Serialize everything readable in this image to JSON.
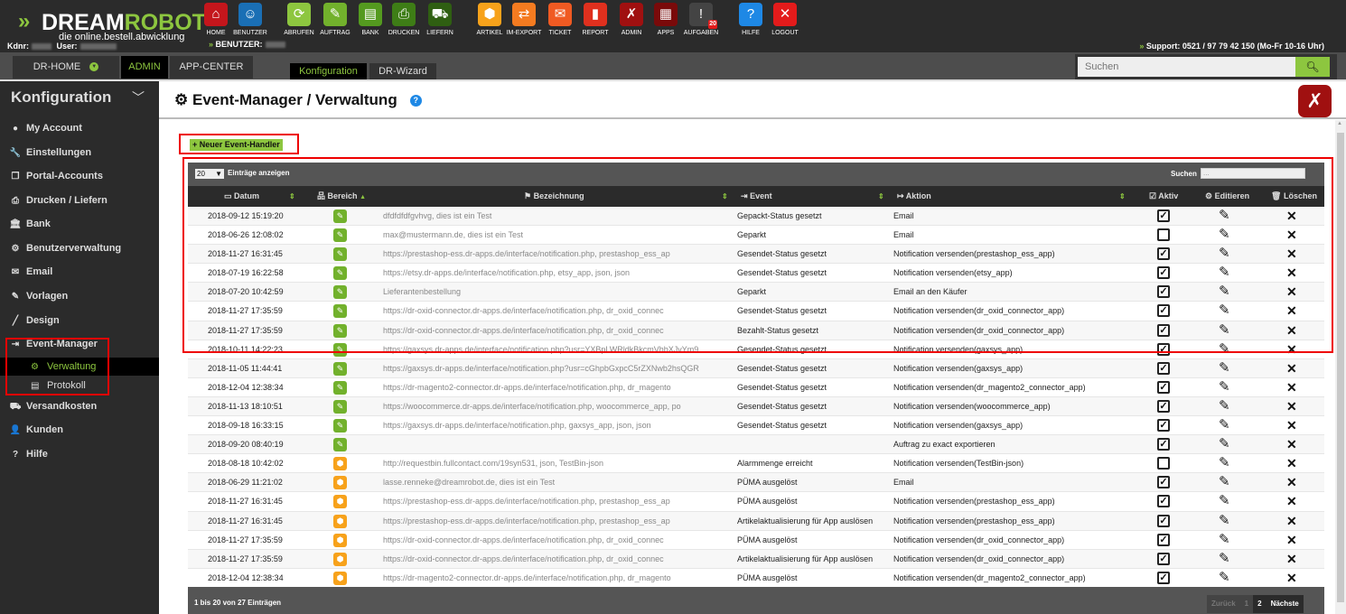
{
  "logo": {
    "brand_a": "DREAM",
    "brand_b": "ROBOT",
    "tagline": "die online.bestell.abwicklung"
  },
  "account": {
    "kdnr_label": "Kdnr:",
    "user_label": "User:",
    "benutzer_label": "BENUTZER:"
  },
  "support": "Support: 0521 / 97 79 42 150 (Mo-Fr 10-16 Uhr)",
  "toolbar": [
    {
      "label": "HOME",
      "icon": "home-icon",
      "glyph": "⌂",
      "color": "#c4161c"
    },
    {
      "label": "BENUTZER",
      "icon": "user-icon",
      "glyph": "☺",
      "color": "#1a6fb5"
    },
    {
      "label": "ABRUFEN",
      "icon": "download-icon",
      "glyph": "⟳",
      "color": "#8dc63f"
    },
    {
      "label": "AUFTRAG",
      "icon": "order-icon",
      "glyph": "✎",
      "color": "#72b12c"
    },
    {
      "label": "BANK",
      "icon": "bank-icon",
      "glyph": "▤",
      "color": "#549a1f"
    },
    {
      "label": "DRUCKEN",
      "icon": "printer-icon",
      "glyph": "⎙",
      "color": "#3e7d16"
    },
    {
      "label": "LIEFERN",
      "icon": "delivery-icon",
      "glyph": "⛟",
      "color": "#2f5f12"
    },
    {
      "label": "ARTIKEL",
      "icon": "article-icon",
      "glyph": "⬢",
      "color": "#f7a21b"
    },
    {
      "label": "IM-EXPORT",
      "icon": "import-export-icon",
      "glyph": "⇄",
      "color": "#f47b20"
    },
    {
      "label": "TICKET",
      "icon": "ticket-icon",
      "glyph": "✉",
      "color": "#f05a22"
    },
    {
      "label": "REPORT",
      "icon": "report-icon",
      "glyph": "▮",
      "color": "#e0301e"
    },
    {
      "label": "ADMIN",
      "icon": "admin-tools-icon",
      "glyph": "✗",
      "color": "#a01010"
    },
    {
      "label": "APPS",
      "icon": "apps-icon",
      "glyph": "▦",
      "color": "#7a0a0a"
    },
    {
      "label": "AUFGABEN",
      "icon": "tasks-icon",
      "glyph": "!",
      "color": "#444444",
      "badge": "20"
    },
    {
      "label": "HILFE",
      "icon": "help-icon",
      "glyph": "?",
      "color": "#1e88e5"
    },
    {
      "label": "LOGOUT",
      "icon": "logout-icon",
      "glyph": "✕",
      "color": "#e31b1b"
    }
  ],
  "nav": {
    "tabs": [
      "DR-HOME",
      "ADMIN",
      "APP-CENTER"
    ],
    "active_tab": "ADMIN",
    "subtabs": [
      "Konfiguration",
      "DR-Wizard"
    ],
    "active_subtab": "Konfiguration",
    "search_placeholder": "Suchen"
  },
  "sidebar": {
    "title": "Konfiguration",
    "items": [
      {
        "label": "My Account",
        "icon": "user-circle-icon",
        "glyph": "●"
      },
      {
        "label": "Einstellungen",
        "icon": "wrench-icon",
        "glyph": "🔧"
      },
      {
        "label": "Portal-Accounts",
        "icon": "copy-icon",
        "glyph": "❐"
      },
      {
        "label": "Drucken / Liefern",
        "icon": "printer-icon",
        "glyph": "⎙"
      },
      {
        "label": "Bank",
        "icon": "bank-icon",
        "glyph": "🏛"
      },
      {
        "label": "Benutzerverwaltung",
        "icon": "users-cog-icon",
        "glyph": "⚙"
      },
      {
        "label": "Email",
        "icon": "envelope-icon",
        "glyph": "✉"
      },
      {
        "label": "Vorlagen",
        "icon": "edit-icon",
        "glyph": "✎"
      },
      {
        "label": "Design",
        "icon": "brush-icon",
        "glyph": "╱"
      },
      {
        "label": "Event-Manager",
        "icon": "sign-in-icon",
        "glyph": "⇥"
      },
      {
        "label": "Versandkosten",
        "icon": "truck-icon",
        "glyph": "⛟"
      },
      {
        "label": "Kunden",
        "icon": "person-icon",
        "glyph": "👤"
      },
      {
        "label": "Hilfe",
        "icon": "question-circle-icon",
        "glyph": "?"
      }
    ],
    "subitems": [
      {
        "label": "Verwaltung",
        "icon": "cog-icon",
        "glyph": "⚙",
        "active": true
      },
      {
        "label": "Protokoll",
        "icon": "log-icon",
        "glyph": "▤",
        "active": false
      }
    ]
  },
  "page": {
    "title": "Event-Manager / Verwaltung",
    "new_button": "+ Neuer Event-Handler"
  },
  "table": {
    "length_value": "20",
    "length_label": "Einträge anzeigen",
    "search_label": "Suchen",
    "search_placeholder": "...",
    "columns": {
      "datum": "Datum",
      "bereich": "Bereich",
      "bezeichnung": "Bezeichnung",
      "event": "Event",
      "aktion": "Aktion",
      "aktiv": "Aktiv",
      "editieren": "Editieren",
      "loeschen": "Löschen"
    },
    "rows": [
      {
        "date": "2018-09-12 15:19:20",
        "area": "order",
        "bez": "dfdfdfdfgvhvg, dies ist ein Test",
        "event": "Gepackt-Status gesetzt",
        "action": "Email",
        "active": true
      },
      {
        "date": "2018-06-26 12:08:02",
        "area": "order",
        "bez": "max@mustermann.de, dies ist ein Test",
        "event": "Geparkt",
        "action": "Email",
        "active": false
      },
      {
        "date": "2018-11-27 16:31:45",
        "area": "order",
        "bez": "https://prestashop-ess.dr-apps.de/interface/notification.php, prestashop_ess_ap",
        "event": "Gesendet-Status gesetzt",
        "action": "Notification versenden(prestashop_ess_app)",
        "active": true
      },
      {
        "date": "2018-07-19 16:22:58",
        "area": "order",
        "bez": "https://etsy.dr-apps.de/interface/notification.php, etsy_app, json, json",
        "event": "Gesendet-Status gesetzt",
        "action": "Notification versenden(etsy_app)",
        "active": true
      },
      {
        "date": "2018-07-20 10:42:59",
        "area": "order",
        "bez": "Lieferantenbestellung",
        "event": "Geparkt",
        "action": "Email an den Käufer",
        "active": true
      },
      {
        "date": "2018-11-27 17:35:59",
        "area": "order",
        "bez": "https://dr-oxid-connector.dr-apps.de/interface/notification.php, dr_oxid_connec",
        "event": "Gesendet-Status gesetzt",
        "action": "Notification versenden(dr_oxid_connector_app)",
        "active": true
      },
      {
        "date": "2018-11-27 17:35:59",
        "area": "order",
        "bez": "https://dr-oxid-connector.dr-apps.de/interface/notification.php, dr_oxid_connec",
        "event": "Bezahlt-Status gesetzt",
        "action": "Notification versenden(dr_oxid_connector_app)",
        "active": true
      },
      {
        "date": "2018-10-11 14:22:23",
        "area": "order",
        "bez": "https://gaxsys.dr-apps.de/interface/notification.php?usr=YXBpLWRldkBkcmVhbXJvYm9",
        "event": "Gesendet-Status gesetzt",
        "action": "Notification versenden(gaxsys_app)",
        "active": true
      },
      {
        "date": "2018-11-05 11:44:41",
        "area": "order",
        "bez": "https://gaxsys.dr-apps.de/interface/notification.php?usr=cGhpbGxpcC5rZXNwb2hsQGR",
        "event": "Gesendet-Status gesetzt",
        "action": "Notification versenden(gaxsys_app)",
        "active": true
      },
      {
        "date": "2018-12-04 12:38:34",
        "area": "order",
        "bez": "https://dr-magento2-connector.dr-apps.de/interface/notification.php, dr_magento",
        "event": "Gesendet-Status gesetzt",
        "action": "Notification versenden(dr_magento2_connector_app)",
        "active": true
      },
      {
        "date": "2018-11-13 18:10:51",
        "area": "order",
        "bez": "https://woocommerce.dr-apps.de/interface/notification.php, woocommerce_app, po",
        "event": "Gesendet-Status gesetzt",
        "action": "Notification versenden(woocommerce_app)",
        "active": true
      },
      {
        "date": "2018-09-18 16:33:15",
        "area": "order",
        "bez": "https://gaxsys.dr-apps.de/interface/notification.php, gaxsys_app, json, json",
        "event": "Gesendet-Status gesetzt",
        "action": "Notification versenden(gaxsys_app)",
        "active": true
      },
      {
        "date": "2018-09-20 08:40:19",
        "area": "order",
        "bez": "",
        "event": "",
        "action": "Auftrag zu exact exportieren",
        "active": true
      },
      {
        "date": "2018-08-18 10:42:02",
        "area": "article",
        "bez": "http://requestbin.fullcontact.com/19syn531, json, TestBin-json",
        "event": "Alarmmenge erreicht",
        "action": "Notification versenden(TestBin-json)",
        "active": false
      },
      {
        "date": "2018-06-29 11:21:02",
        "area": "article",
        "bez": "lasse.renneke@dreamrobot.de, dies ist ein Test",
        "event": "PÜMA ausgelöst",
        "action": "Email",
        "active": true
      },
      {
        "date": "2018-11-27 16:31:45",
        "area": "article",
        "bez": "https://prestashop-ess.dr-apps.de/interface/notification.php, prestashop_ess_ap",
        "event": "PÜMA ausgelöst",
        "action": "Notification versenden(prestashop_ess_app)",
        "active": true
      },
      {
        "date": "2018-11-27 16:31:45",
        "area": "article",
        "bez": "https://prestashop-ess.dr-apps.de/interface/notification.php, prestashop_ess_ap",
        "event": "Artikelaktualisierung für App auslösen",
        "action": "Notification versenden(prestashop_ess_app)",
        "active": true
      },
      {
        "date": "2018-11-27 17:35:59",
        "area": "article",
        "bez": "https://dr-oxid-connector.dr-apps.de/interface/notification.php, dr_oxid_connec",
        "event": "PÜMA ausgelöst",
        "action": "Notification versenden(dr_oxid_connector_app)",
        "active": true
      },
      {
        "date": "2018-11-27 17:35:59",
        "area": "article",
        "bez": "https://dr-oxid-connector.dr-apps.de/interface/notification.php, dr_oxid_connec",
        "event": "Artikelaktualisierung für App auslösen",
        "action": "Notification versenden(dr_oxid_connector_app)",
        "active": true
      },
      {
        "date": "2018-12-04 12:38:34",
        "area": "article",
        "bez": "https://dr-magento2-connector.dr-apps.de/interface/notification.php, dr_magento",
        "event": "PÜMA ausgelöst",
        "action": "Notification versenden(dr_magento2_connector_app)",
        "active": true
      }
    ],
    "info": "1 bis 20 von 27 Einträgen",
    "pager": {
      "prev": "Zurück",
      "pages": [
        "1",
        "2"
      ],
      "current": "2",
      "next": "Nächste"
    }
  },
  "colors": {
    "accent": "#8dc63f",
    "area_order": "#72b12c",
    "area_article": "#f7a21b",
    "highlight": "#e00000"
  }
}
